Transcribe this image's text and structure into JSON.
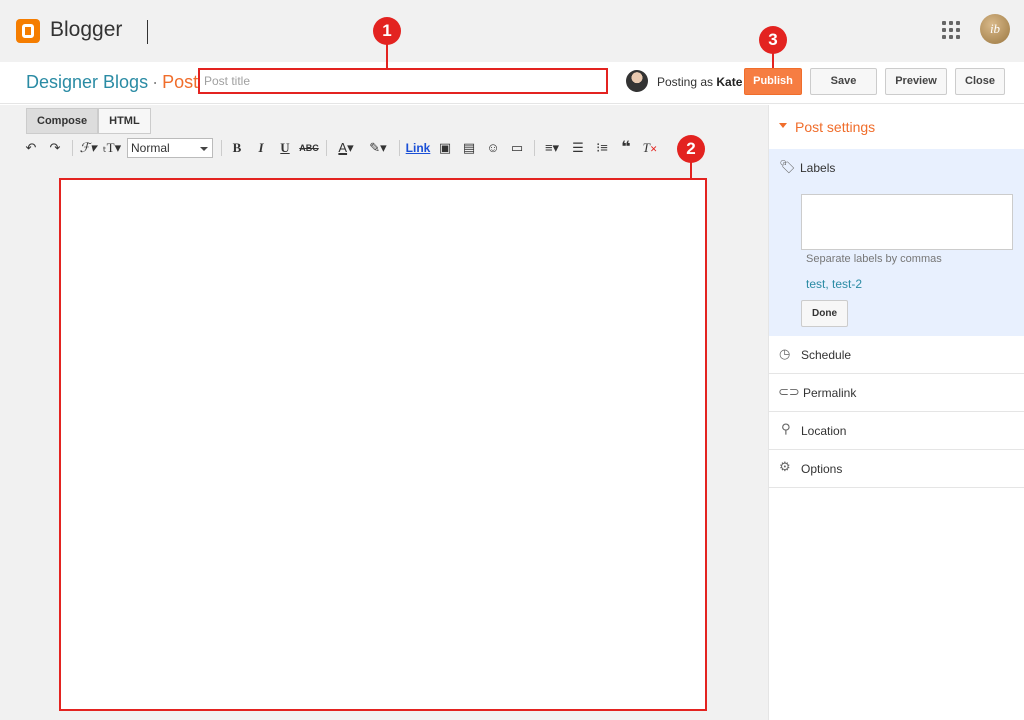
{
  "app": {
    "brand": "Blogger"
  },
  "breadcrumb": {
    "blog": "Designer Blogs",
    "separator": "·",
    "page": "Post"
  },
  "post_title": {
    "placeholder": "Post title",
    "value": ""
  },
  "user": {
    "posting_prefix": "Posting as",
    "name": "Kate",
    "avatar_initials": "ib"
  },
  "actions": {
    "publish": "Publish",
    "save": "Save",
    "preview": "Preview",
    "close": "Close"
  },
  "editor": {
    "tabs": [
      "Compose",
      "HTML"
    ],
    "format_select": "Normal",
    "link_label": "Link"
  },
  "markers": [
    "1",
    "2",
    "3"
  ],
  "sidebar": {
    "header": "Post settings",
    "labels": {
      "title": "Labels",
      "hint": "Separate labels by commas",
      "tags": "test, test-2",
      "done": "Done"
    },
    "items": [
      "Schedule",
      "Permalink",
      "Location",
      "Options"
    ]
  },
  "colors": {
    "accent": "#f06d2b",
    "annotation": "#e32320",
    "link": "#2a8ba4"
  }
}
